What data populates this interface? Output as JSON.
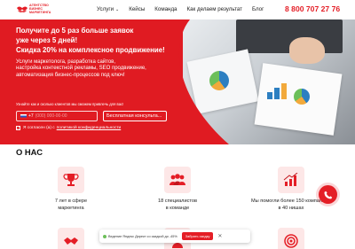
{
  "header": {
    "logo": {
      "line1": "АГЕНТСТВО",
      "line2": "БИЗНЕС",
      "line3": "МАРКЕТИНГА",
      "color": "#e41e26"
    },
    "nav": [
      {
        "label": "Услуги",
        "has_dropdown": true
      },
      {
        "label": "Кейсы"
      },
      {
        "label": "Команда"
      },
      {
        "label": "Как делаем результат"
      },
      {
        "label": "Блог"
      }
    ],
    "phone": "8 800 707 27 76"
  },
  "hero": {
    "title_lines": [
      "Получите до 5 раз больше заявок",
      "уже через 5 дней!",
      "Скидка 20% на комплексное продвижение!"
    ],
    "subtitle_lines": [
      "Услуги маркетолога, разработка сайтов,",
      "настройка контекстной рекламы, SEO продвижение,",
      "автоматизация бизнес-процессов под ключ!"
    ],
    "form_note": "Узнайте как и сколько клиентов мы сможем привлечь для вас!",
    "phone_code": "+7",
    "phone_placeholder": "(000) 000-00-00",
    "consult_button": "Бесплатная консульта...",
    "consent_text": "Я согласен (а) с",
    "consent_link": "политикой конфиденциальности",
    "accent_color": "#e01b22"
  },
  "about": {
    "title": "О НАС",
    "features": [
      {
        "icon": "trophy-icon",
        "lines": [
          "7 лет в сфере",
          "маркетинга"
        ]
      },
      {
        "icon": "team-icon",
        "lines": [
          "18 специалистов",
          "в команде"
        ]
      },
      {
        "icon": "growth-chart-icon",
        "lines": [
          "Мы помогли более 150 компаниям",
          "в 40 нишах"
        ]
      },
      {
        "icon": "handshake-icon",
        "lines": []
      },
      {
        "icon": "person-icon",
        "lines": []
      },
      {
        "icon": "target-icon",
        "lines": []
      }
    ]
  },
  "promo_bar": {
    "text": "Ведение Яндекс Директ со скидкой до -45%",
    "button": "Забрать скидку",
    "close": "✕"
  }
}
